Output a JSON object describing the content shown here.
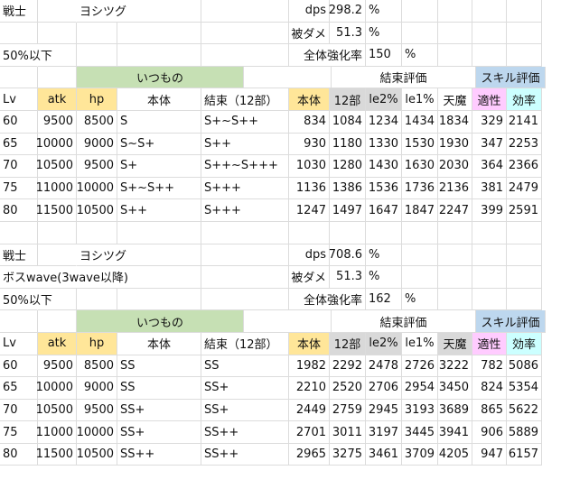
{
  "s1": {
    "r1": [
      "戦士",
      "ヨシツグ",
      "dps",
      "298.2",
      "%"
    ],
    "r2": [
      "被ダメ",
      "51.3",
      "%"
    ],
    "r3": [
      "50%以下",
      "全体強化率",
      "150",
      "%"
    ],
    "hdr1": [
      "いつもの",
      "結束評価",
      "スキル評価"
    ],
    "hdr2": [
      "Lv",
      "atk",
      "hp",
      "本体",
      "結束（12部）",
      "本体",
      "12部",
      "le2%",
      "le1%",
      "天魔",
      "適性",
      "効率"
    ],
    "rows": [
      [
        "60",
        "9500",
        "8500",
        "S",
        "S+~S++",
        "834",
        "1084",
        "1234",
        "1434",
        "1834",
        "329",
        "2141"
      ],
      [
        "65",
        "10000",
        "9000",
        "S~S+",
        "S++",
        "930",
        "1180",
        "1330",
        "1530",
        "1930",
        "347",
        "2253"
      ],
      [
        "70",
        "10500",
        "9500",
        "S+",
        "S++~S+++",
        "1030",
        "1280",
        "1430",
        "1630",
        "2030",
        "364",
        "2366"
      ],
      [
        "75",
        "11000",
        "10000",
        "S+~S++",
        "S+++",
        "1136",
        "1386",
        "1536",
        "1736",
        "2136",
        "381",
        "2479"
      ],
      [
        "80",
        "11500",
        "10500",
        "S++",
        "S+++",
        "1247",
        "1497",
        "1647",
        "1847",
        "2247",
        "399",
        "2591"
      ]
    ]
  },
  "s2": {
    "r1": [
      "戦士",
      "ヨシツグ",
      "dps",
      "708.6",
      "%"
    ],
    "r2": [
      "ボスwave(3wave以降)",
      "被ダメ",
      "51.3",
      "%"
    ],
    "r3": [
      "50%以下",
      "全体強化率",
      "162",
      "%"
    ],
    "hdr1": [
      "いつもの",
      "結束評価",
      "スキル評価"
    ],
    "hdr2": [
      "Lv",
      "atk",
      "hp",
      "本体",
      "結束（12部）",
      "本体",
      "12部",
      "le2%",
      "le1%",
      "天魔",
      "適性",
      "効率"
    ],
    "rows": [
      [
        "60",
        "9500",
        "8500",
        "SS",
        "SS",
        "1982",
        "2292",
        "2478",
        "2726",
        "3222",
        "782",
        "5086"
      ],
      [
        "65",
        "10000",
        "9000",
        "SS",
        "SS+",
        "2210",
        "2520",
        "2706",
        "2954",
        "3450",
        "824",
        "5354"
      ],
      [
        "70",
        "10500",
        "9500",
        "SS+",
        "SS+",
        "2449",
        "2759",
        "2945",
        "3193",
        "3689",
        "865",
        "5622"
      ],
      [
        "75",
        "11000",
        "10000",
        "SS+",
        "SS++",
        "2701",
        "3011",
        "3197",
        "3445",
        "3941",
        "906",
        "5889"
      ],
      [
        "80",
        "11500",
        "10500",
        "SS++",
        "SS++",
        "2965",
        "3275",
        "3461",
        "3709",
        "4205",
        "947",
        "6157"
      ]
    ]
  }
}
